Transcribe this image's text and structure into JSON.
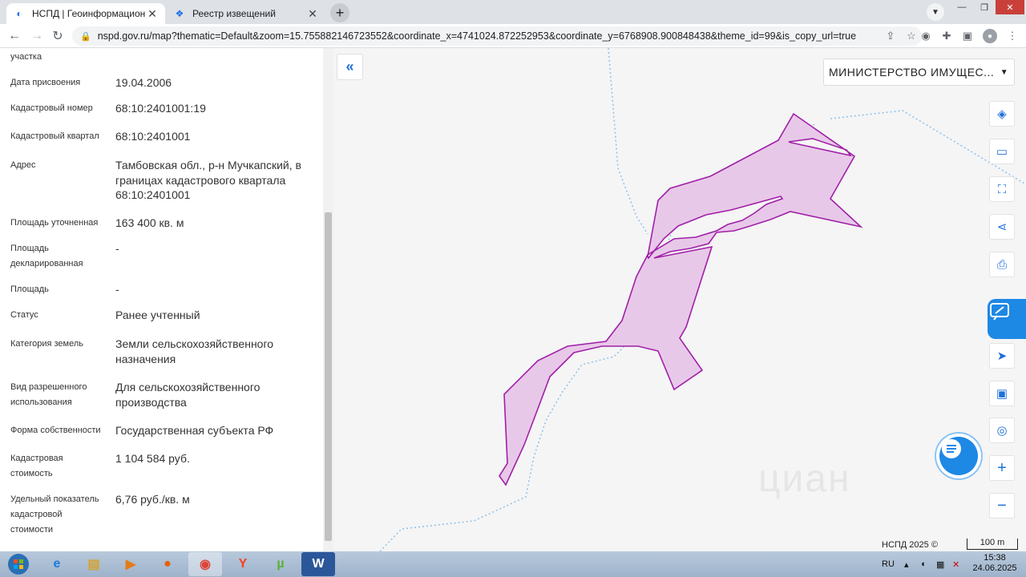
{
  "browser": {
    "tabs": [
      {
        "title": "НСПД | Геоинформационный п",
        "active": true
      },
      {
        "title": "Реестр извещений",
        "active": false
      }
    ],
    "url": "nspd.gov.ru/map?thematic=Default&zoom=15.755882146723552&coordinate_x=4741024.872252953&coordinate_y=6768908.900848438&theme_id=99&is_copy_url=true"
  },
  "panel": {
    "top_fragment": "участка",
    "rows": [
      {
        "label": "Дата присвоения",
        "value": "19.04.2006"
      },
      {
        "label": "Кадастровый номер",
        "value": "68:10:2401001:19"
      },
      {
        "label": "Кадастровый квартал",
        "value": "68:10:2401001"
      },
      {
        "label": "Адрес",
        "value": "Тамбовская обл., р-н Мучкапский, в границах кадастрового квартала 68:10:2401001"
      },
      {
        "label": "Площадь уточненная",
        "value": "163 400 кв. м"
      },
      {
        "label": "Площадь декларированная",
        "value": "-"
      },
      {
        "label": "Площадь",
        "value": "-"
      },
      {
        "label": "Статус",
        "value": "Ранее учтенный"
      },
      {
        "label": "Категория земель",
        "value": "Земли сельскохозяйственного назначения"
      },
      {
        "label": "Вид разрешенного использования",
        "value": "Для сельскохозяйственного производства"
      },
      {
        "label": "Форма собственности",
        "value": "Государственная субъекта РФ"
      },
      {
        "label": "Кадастровая стоимость",
        "value": "1 104 584 руб."
      },
      {
        "label": "Удельный показатель кадастровой стоимости",
        "value": "6,76 руб./кв. м"
      }
    ]
  },
  "map": {
    "layer_select": "МИНИСТЕРСТВО ИМУЩЕС...",
    "attribution": "НСПД 2025 ©",
    "scale_label": "100 m",
    "watermark": "циан",
    "parcel_fill": "#e8c8e8",
    "parcel_stroke": "#a020a8",
    "boundary_color": "#8fbfe8"
  },
  "taskbar": {
    "lang": "RU",
    "time": "15:38",
    "date": "24.06.2025"
  }
}
